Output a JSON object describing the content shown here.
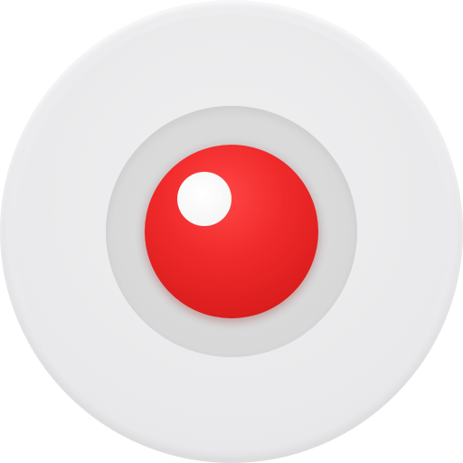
{
  "icon": {
    "name": "record-icon",
    "colors": {
      "outer_disc": "#ececee",
      "inner_well": "#d9d9da",
      "record_red": "#e32222",
      "highlight": "#ffffff"
    }
  }
}
